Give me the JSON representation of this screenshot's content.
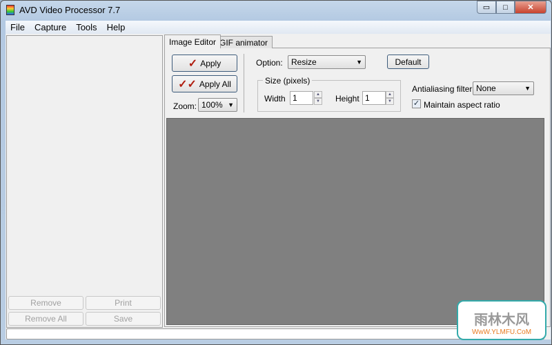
{
  "window": {
    "title": "AVD Video Processor 7.7",
    "minimize": "▭",
    "maximize": "□",
    "close": "✕"
  },
  "menu": [
    "File",
    "Capture",
    "Tools",
    "Help"
  ],
  "left_panel": {
    "remove": "Remove",
    "print": "Print",
    "remove_all": "Remove All",
    "save": "Save"
  },
  "tabs": [
    {
      "label": "Image Editor",
      "active": true
    },
    {
      "label": "GIF animator",
      "active": false
    }
  ],
  "editor": {
    "apply": "Apply",
    "apply_all": "Apply All",
    "check": "✓",
    "check2": "✓✓",
    "zoom_label": "Zoom:",
    "zoom_value": "100%",
    "option_label": "Option:",
    "option_value": "Resize",
    "default": "Default",
    "size_group": "Size (pixels)",
    "width_label": "Width",
    "width_value": "1",
    "height_label": "Height",
    "height_value": "1",
    "aa_label": "Antialiasing filter:",
    "aa_value": "None",
    "maintain_label": "Maintain aspect ratio",
    "maintain_checked": true
  },
  "canvas_color": "#808080",
  "watermark": {
    "cn": "雨林木风",
    "url": "WwW.YLMFU.CoM"
  }
}
